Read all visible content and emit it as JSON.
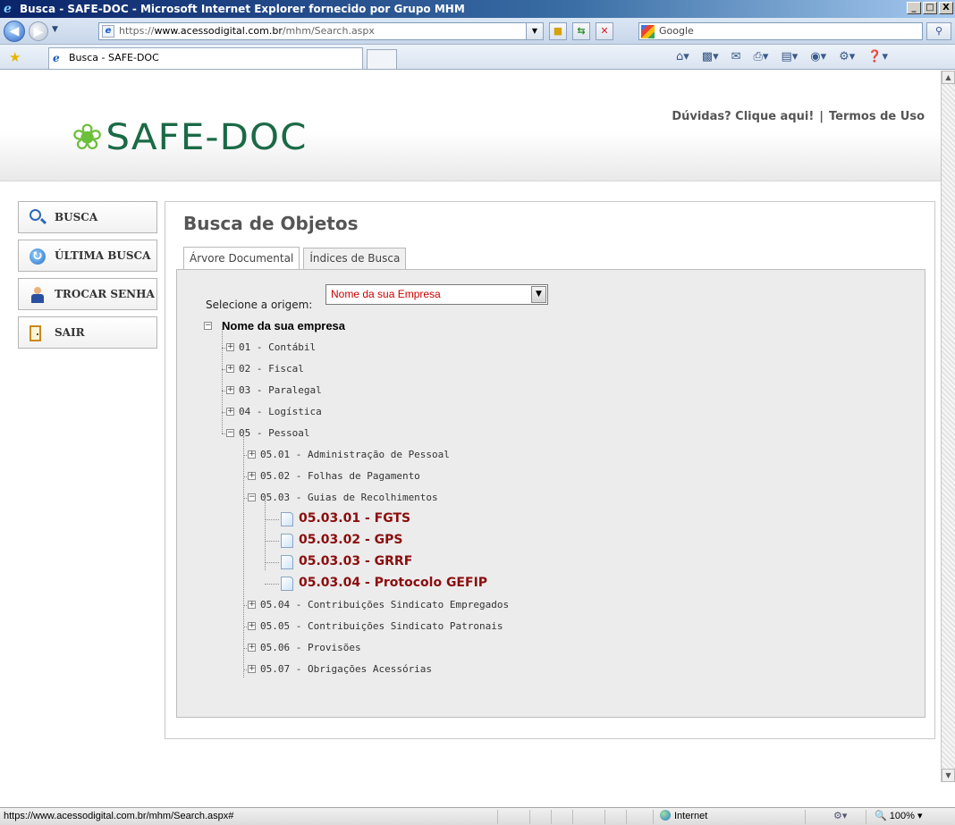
{
  "window": {
    "title": "Busca - SAFE-DOC - Microsoft Internet Explorer fornecido por Grupo MHM",
    "buttons": [
      "_",
      "□",
      "X"
    ]
  },
  "address": {
    "url_prefix": "https://",
    "url_host": "www.acessodigital.com.br",
    "url_path": "/mhm/Search.aspx",
    "search_placeholder": "Google"
  },
  "tab": {
    "label": "Busca - SAFE-DOC"
  },
  "header": {
    "logo": "SAFE-DOC",
    "links": [
      "Dúvidas? Clique aqui!",
      "Termos de Uso"
    ],
    "separator": "|"
  },
  "sidebar": {
    "items": [
      {
        "label": "BUSCA",
        "icon": "search-icon"
      },
      {
        "label": "ÚLTIMA BUSCA",
        "icon": "last-search-icon"
      },
      {
        "label": "TROCAR SENHA",
        "icon": "user-key-icon"
      },
      {
        "label": "SAIR",
        "icon": "exit-door-icon"
      }
    ]
  },
  "main": {
    "title": "Busca de Objetos",
    "tabs": [
      "Árvore Documental",
      "Índices de Busca"
    ],
    "origin_label": "Selecione a origem:",
    "origin_value": "Nome da sua Empresa",
    "tree": {
      "root": "Nome da sua empresa",
      "level1": [
        "01 - Contábil",
        "02 - Fiscal",
        "03 - Paralegal",
        "04 - Logística",
        "05 - Pessoal"
      ],
      "level2": [
        "05.01 - Administração de Pessoal",
        "05.02 - Folhas de Pagamento",
        "05.03 - Guias de Recolhimentos",
        "05.04 - Contribuições Sindicato Empregados",
        "05.05 - Contribuições Sindicato Patronais",
        "05.06 - Provisões",
        "05.07 - Obrigações Acessórias"
      ],
      "leaves": [
        "05.03.01 - FGTS",
        "05.03.02 - GPS",
        "05.03.03 - GRRF",
        "05.03.04 - Protocolo GEFIP"
      ]
    }
  },
  "status": {
    "url": "https://www.acessodigital.com.br/mhm/Search.aspx#",
    "zone": "Internet",
    "zoom": "100%"
  }
}
